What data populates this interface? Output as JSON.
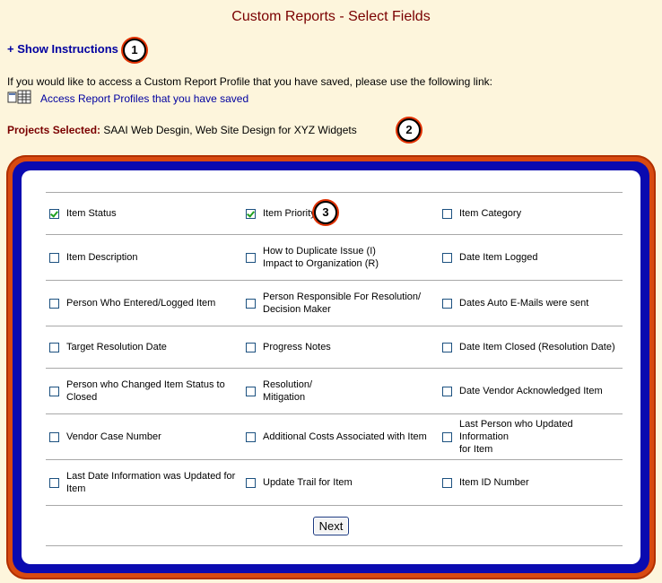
{
  "page": {
    "title": "Custom Reports - Select Fields"
  },
  "instructions": {
    "toggle_label": "+ Show Instructions"
  },
  "callouts": {
    "one": "1",
    "two": "2",
    "three": "3"
  },
  "intro": {
    "text": "If you would like to access a Custom Report Profile that you have saved, please use the following link:",
    "link_label": "Access Report Profiles that you have saved",
    "link_icon": "report-profiles-icon"
  },
  "projects": {
    "label": "Projects Selected:",
    "value": "SAAI Web Desgin, Web Site Design for XYZ Widgets"
  },
  "fields": [
    [
      {
        "label": "Item Status",
        "checked": true
      },
      {
        "label": "Item Priority",
        "checked": true
      },
      {
        "label": "Item Category",
        "checked": false
      }
    ],
    [
      {
        "label": "Item Description",
        "checked": false
      },
      {
        "label": "How to Duplicate Issue (I)\nImpact to Organization (R)",
        "checked": false
      },
      {
        "label": "Date Item Logged",
        "checked": false
      }
    ],
    [
      {
        "label": "Person Who Entered/Logged Item",
        "checked": false
      },
      {
        "label": "Person Responsible For Resolution/\nDecision Maker",
        "checked": false
      },
      {
        "label": "Dates Auto E-Mails were sent",
        "checked": false
      }
    ],
    [
      {
        "label": "Target Resolution Date",
        "checked": false
      },
      {
        "label": "Progress Notes",
        "checked": false
      },
      {
        "label": "Date Item Closed (Resolution Date)",
        "checked": false
      }
    ],
    [
      {
        "label": "Person who Changed Item Status to\nClosed",
        "checked": false
      },
      {
        "label": "Resolution/\nMitigation",
        "checked": false
      },
      {
        "label": "Date Vendor Acknowledged Item",
        "checked": false
      }
    ],
    [
      {
        "label": "Vendor Case Number",
        "checked": false
      },
      {
        "label": "Additional Costs Associated with Item",
        "checked": false
      },
      {
        "label": "Last Person who Updated Information\nfor Item",
        "checked": false
      }
    ],
    [
      {
        "label": "Last Date Information was Updated for\nItem",
        "checked": false
      },
      {
        "label": "Update Trail for Item",
        "checked": false
      },
      {
        "label": "Item ID Number",
        "checked": false
      }
    ]
  ],
  "actions": {
    "next_label": "Next"
  },
  "colors": {
    "background": "#fdf5dc",
    "frame_outer": "#d84a10",
    "frame_inner": "#0a0ab0",
    "link": "#0000a0",
    "title": "#7a0000"
  }
}
